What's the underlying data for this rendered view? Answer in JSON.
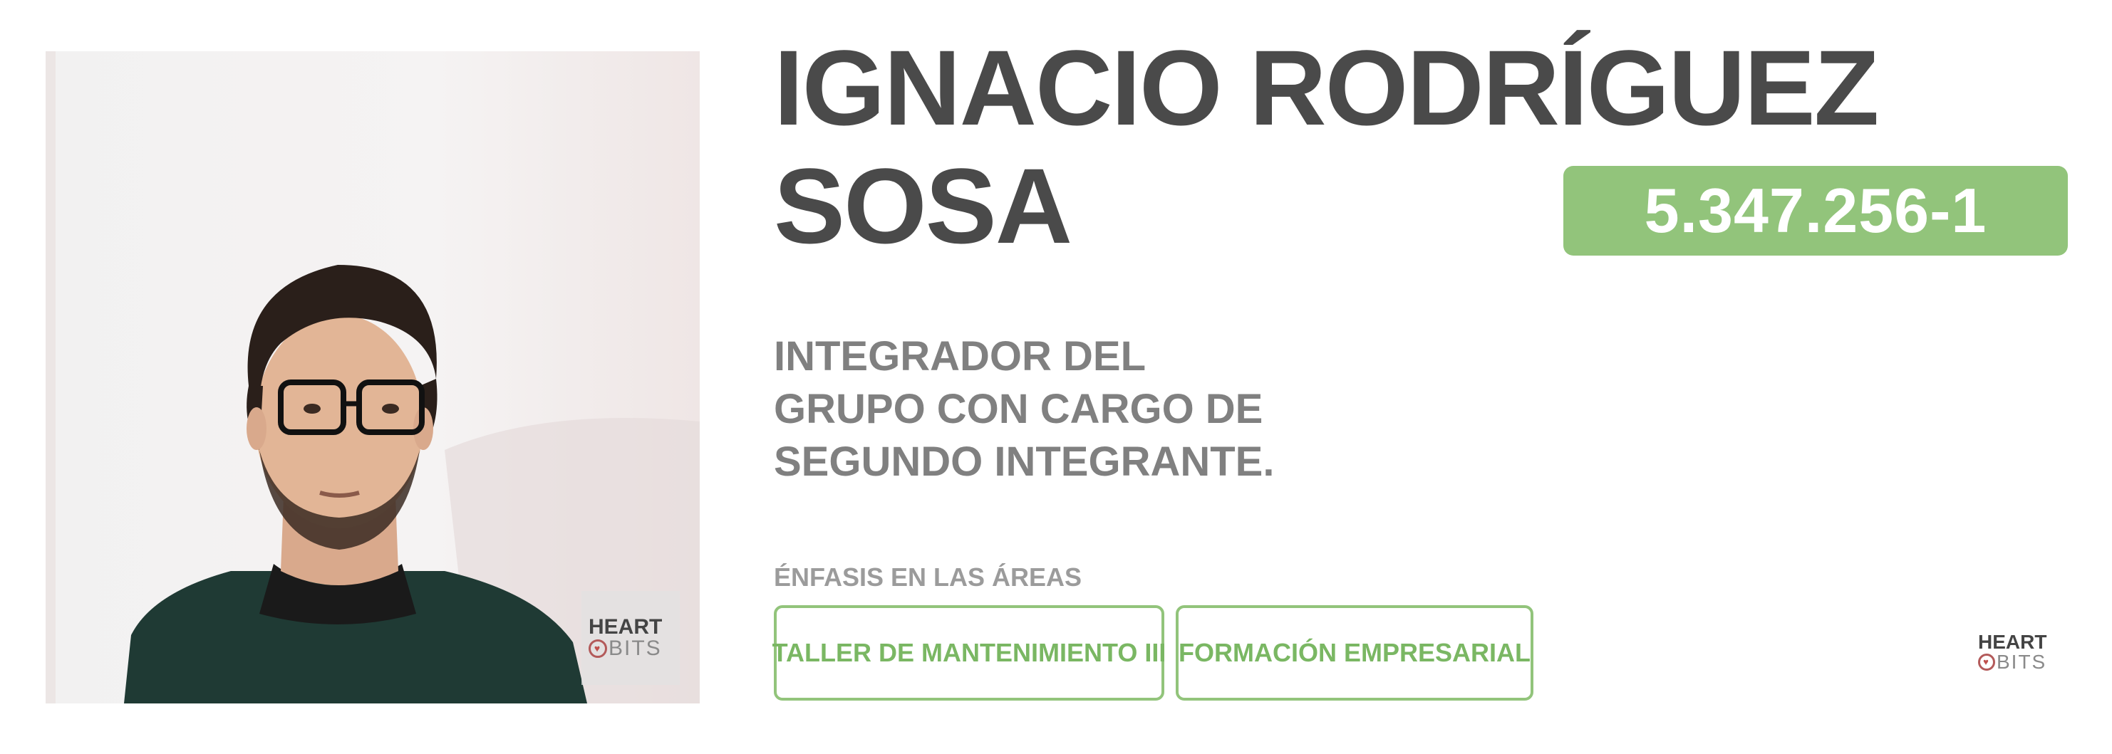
{
  "profile": {
    "name_line1": "IGNACIO RODRÍGUEZ",
    "name_line2": "SOSA",
    "id_number": "5.347.256-1",
    "role_line1": "INTEGRADOR DEL",
    "role_line2": "GRUPO CON CARGO DE",
    "role_line3": "SEGUNDO INTEGRANTE.",
    "photo_icon": "person-photo"
  },
  "areas": {
    "label": "ÉNFASIS EN LAS ÁREAS",
    "items": [
      {
        "label": "TALLER DE MANTENIMIENTO III"
      },
      {
        "label": "FORMACIÓN EMPRESARIAL"
      }
    ]
  },
  "logo": {
    "top": "HEART",
    "bottom": "BITS",
    "icon": "heart-icon"
  },
  "colors": {
    "accent_green": "#92c47b",
    "name_text": "#4a4a4a",
    "role_text": "#808080",
    "label_text": "#9b9b9b"
  }
}
